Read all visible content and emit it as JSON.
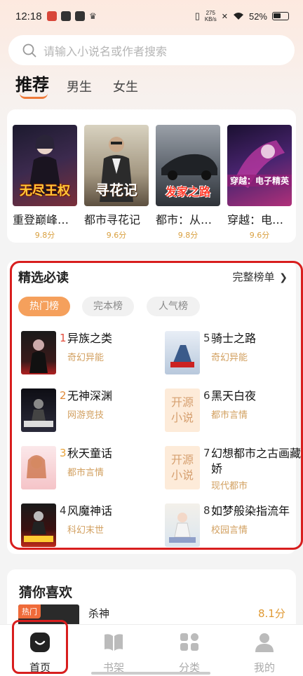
{
  "status_bar": {
    "time": "12:18",
    "speed": "275\nKB/s",
    "battery": "52%"
  },
  "search": {
    "placeholder": "请输入小说名或作者搜索"
  },
  "top_tabs": [
    {
      "label": "推荐",
      "active": true
    },
    {
      "label": "男生",
      "active": false
    },
    {
      "label": "女生",
      "active": false
    }
  ],
  "recommended": [
    {
      "title": "重登巅峰之无尽王权",
      "cover_text": "无尽王权",
      "score": "9.8分"
    },
    {
      "title": "都市寻花记",
      "cover_text": "寻花记",
      "score": "9.6分"
    },
    {
      "title": "都市：从汽车开始的发家之路",
      "cover_text": "发家之路",
      "score": "9.8分"
    },
    {
      "title": "穿越：电子精英",
      "cover_text": "穿越：电子精英",
      "score": "9.6分"
    }
  ],
  "featured": {
    "title": "精选必读",
    "more_label": "完整榜单",
    "more_icon": "chevron-right-icon",
    "pills": [
      {
        "label": "热门榜",
        "active": true
      },
      {
        "label": "完本榜",
        "active": false
      },
      {
        "label": "人气榜",
        "active": false
      }
    ],
    "items": [
      {
        "rank": "1",
        "name": "异族之类",
        "genre": "奇幻异能",
        "cover": "image"
      },
      {
        "rank": "5",
        "name": "骑士之路",
        "genre": "奇幻异能",
        "cover": "image"
      },
      {
        "rank": "2",
        "name": "无神深渊",
        "genre": "网游竞技",
        "cover": "image"
      },
      {
        "rank": "6",
        "name": "黑天白夜",
        "genre": "都市言情",
        "cover": "开源小说"
      },
      {
        "rank": "3",
        "name": "秋天童话",
        "genre": "都市言情",
        "cover": "image"
      },
      {
        "rank": "7",
        "name": "幻想都市之古画藏娇",
        "genre": "现代都市",
        "cover": "开源小说"
      },
      {
        "rank": "4",
        "name": "风魔神话",
        "genre": "科幻末世",
        "cover": "image"
      },
      {
        "rank": "8",
        "name": "如梦般染指流年",
        "genre": "校园言情",
        "cover": "image"
      }
    ]
  },
  "guess": {
    "title": "猜你喜欢",
    "badge": "热门",
    "book_name": "杀神",
    "score": "8.1分"
  },
  "bottom_nav": [
    {
      "label": "首页",
      "icon": "home-icon",
      "active": true
    },
    {
      "label": "书架",
      "icon": "bookshelf-icon",
      "active": false
    },
    {
      "label": "分类",
      "icon": "category-icon",
      "active": false
    },
    {
      "label": "我的",
      "icon": "profile-icon",
      "active": false
    }
  ],
  "colors": {
    "accent": "#f5a05c",
    "highlight_frame": "#d81e1e",
    "score": "#d9a040"
  }
}
